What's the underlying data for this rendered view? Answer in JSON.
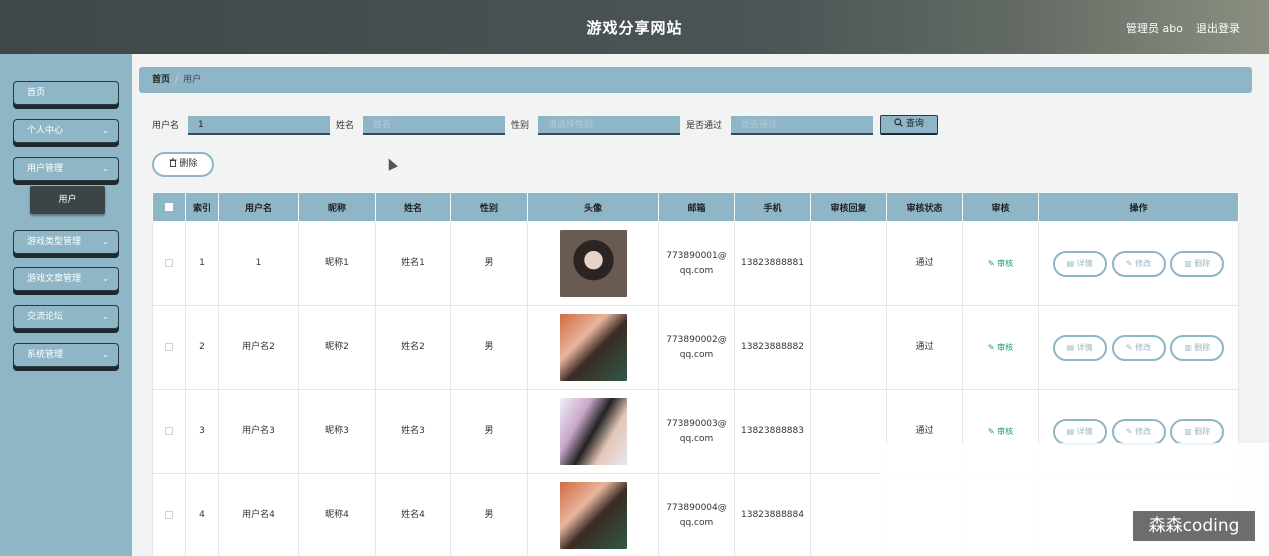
{
  "header": {
    "title": "游戏分享网站",
    "user": "管理员 abo",
    "logout": "退出登录"
  },
  "sidebar": {
    "items": [
      {
        "label": "首页",
        "chevron": false
      },
      {
        "label": "个人中心",
        "chevron": true
      },
      {
        "label": "用户管理",
        "chevron": true
      },
      {
        "label": "游戏类型管理",
        "chevron": true
      },
      {
        "label": "游戏文章管理",
        "chevron": true
      },
      {
        "label": "交流论坛",
        "chevron": true
      },
      {
        "label": "系统管理",
        "chevron": true
      }
    ],
    "active_sub": "用户",
    "chevron_glyph": "⌄"
  },
  "breadcrumb": {
    "home": "首页",
    "sep": "/",
    "current": "用户"
  },
  "filters": {
    "username_label": "用户名",
    "username_value": "1",
    "name_label": "姓名",
    "name_placeholder": "姓名",
    "gender_label": "性别",
    "gender_placeholder": "请选择性别",
    "approved_label": "是否通过",
    "approved_placeholder": "是否通过",
    "search_label": "查询"
  },
  "toolbar": {
    "delete_label": "删除"
  },
  "table": {
    "headers": [
      "",
      "索引",
      "用户名",
      "昵称",
      "姓名",
      "性别",
      "头像",
      "邮箱",
      "手机",
      "审核回复",
      "审核状态",
      "审核",
      "操作"
    ],
    "rows": [
      {
        "index": "1",
        "username": "1",
        "nickname": "昵称1",
        "name": "姓名1",
        "gender": "男",
        "email": "773890001@qq.com",
        "phone": "13823888881",
        "reply": "",
        "status": "通过"
      },
      {
        "index": "2",
        "username": "用户名2",
        "nickname": "昵称2",
        "name": "姓名2",
        "gender": "男",
        "email": "773890002@qq.com",
        "phone": "13823888882",
        "reply": "",
        "status": "通过"
      },
      {
        "index": "3",
        "username": "用户名3",
        "nickname": "昵称3",
        "name": "姓名3",
        "gender": "男",
        "email": "773890003@qq.com",
        "phone": "13823888883",
        "reply": "",
        "status": "通过"
      },
      {
        "index": "4",
        "username": "用户名4",
        "nickname": "昵称4",
        "name": "姓名4",
        "gender": "男",
        "email": "773890004@qq.com",
        "phone": "13823888884",
        "reply": "",
        "status": ""
      }
    ],
    "audit_label": "审核",
    "actions": {
      "detail": "详情",
      "edit": "修改",
      "delete": "删除"
    }
  },
  "icons": {
    "search": "search-icon",
    "trash": "trash-icon",
    "pencil": "pencil-icon",
    "doc": "doc-icon",
    "chevron": "chevron-down-icon"
  },
  "colors": {
    "accent": "#8fb6c7",
    "header_bg": "#444c4e",
    "audit": "#1a9a6a"
  },
  "watermark": "森森coding"
}
